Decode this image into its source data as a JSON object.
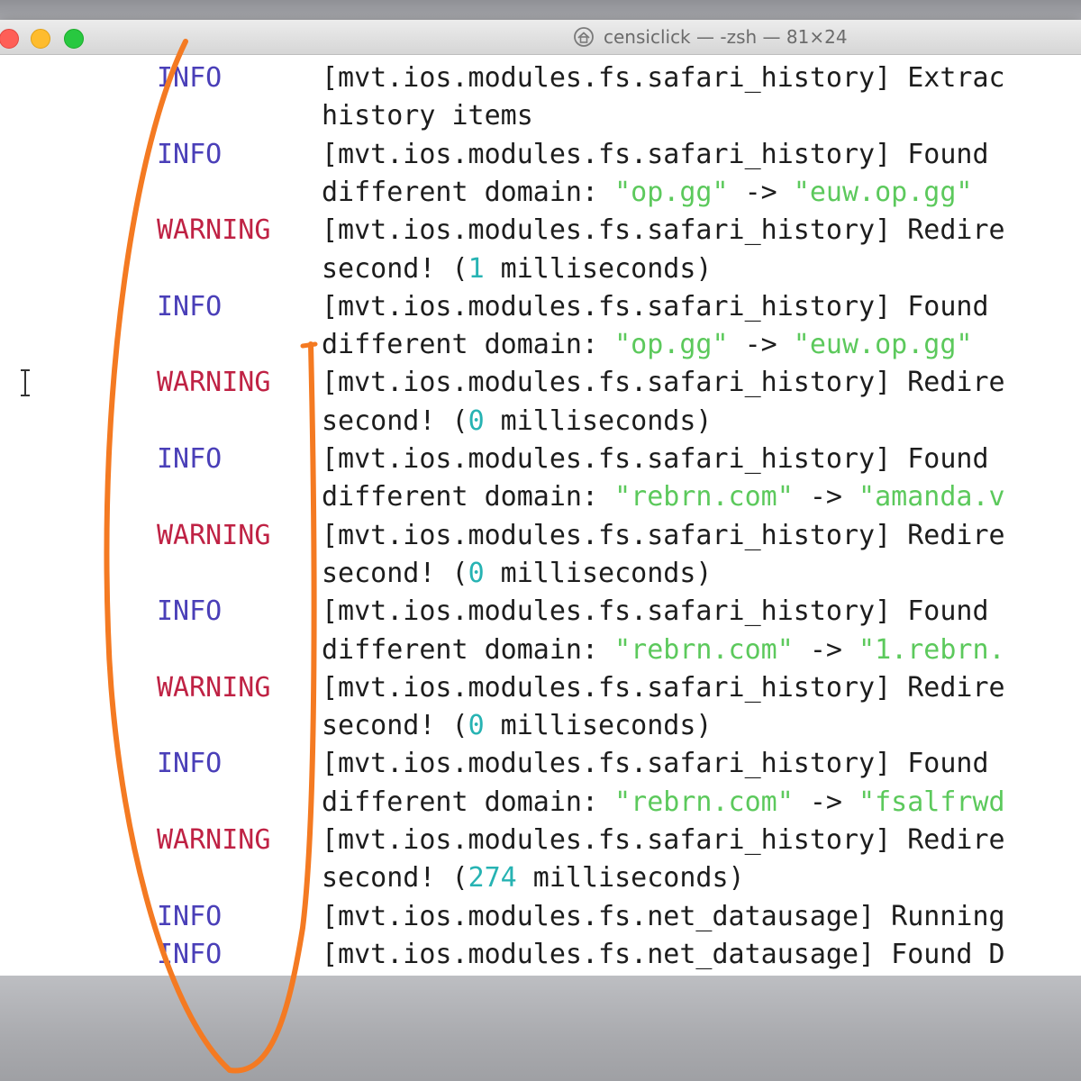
{
  "window": {
    "title": "censiclick — -zsh — 81×24"
  },
  "icons": {
    "title_icon": "home-icon",
    "cursor": "text-cursor-icon"
  },
  "colors": {
    "info": "#4a3fb8",
    "warning": "#bf2244",
    "string": "#5cc95c",
    "number": "#27b3b3",
    "annotation": "#f47a22"
  },
  "log": [
    {
      "level": "INFO",
      "text": "[mvt.ios.modules.fs.safari_history] Extrac"
    },
    {
      "level": "",
      "text": "history items"
    },
    {
      "level": "INFO",
      "text": "[mvt.ios.modules.fs.safari_history] Found"
    },
    {
      "level": "",
      "pre": "different domain: ",
      "s1": "\"op.gg\"",
      "mid": " -> ",
      "s2": "\"euw.op.gg\""
    },
    {
      "level": "WARNING",
      "text": "[mvt.ios.modules.fs.safari_history] Redire"
    },
    {
      "level": "",
      "pre": "second! (",
      "n": "1",
      "post": " milliseconds)"
    },
    {
      "level": "INFO",
      "text": "[mvt.ios.modules.fs.safari_history] Found"
    },
    {
      "level": "",
      "pre": "different domain: ",
      "s1": "\"op.gg\"",
      "mid": " -> ",
      "s2": "\"euw.op.gg\""
    },
    {
      "level": "WARNING",
      "text": "[mvt.ios.modules.fs.safari_history] Redire"
    },
    {
      "level": "",
      "pre": "second! (",
      "n": "0",
      "post": " milliseconds)"
    },
    {
      "level": "INFO",
      "text": "[mvt.ios.modules.fs.safari_history] Found"
    },
    {
      "level": "",
      "pre": "different domain: ",
      "s1": "\"rebrn.com\"",
      "mid": " -> ",
      "s2": "\"amanda.v"
    },
    {
      "level": "WARNING",
      "text": "[mvt.ios.modules.fs.safari_history] Redire"
    },
    {
      "level": "",
      "pre": "second! (",
      "n": "0",
      "post": " milliseconds)"
    },
    {
      "level": "INFO",
      "text": "[mvt.ios.modules.fs.safari_history] Found"
    },
    {
      "level": "",
      "pre": "different domain: ",
      "s1": "\"rebrn.com\"",
      "mid": " -> ",
      "s2": "\"1.rebrn."
    },
    {
      "level": "WARNING",
      "text": "[mvt.ios.modules.fs.safari_history] Redire"
    },
    {
      "level": "",
      "pre": "second! (",
      "n": "0",
      "post": " milliseconds)"
    },
    {
      "level": "INFO",
      "text": "[mvt.ios.modules.fs.safari_history] Found"
    },
    {
      "level": "",
      "pre": "different domain: ",
      "s1": "\"rebrn.com\"",
      "mid": " -> ",
      "s2": "\"fsalfrwd"
    },
    {
      "level": "WARNING",
      "text": "[mvt.ios.modules.fs.safari_history] Redire"
    },
    {
      "level": "",
      "pre": "second! (",
      "n": "274",
      "post": " milliseconds)"
    },
    {
      "level": "INFO",
      "text": "[mvt.ios.modules.fs.net_datausage] Running"
    },
    {
      "level": "INFO",
      "text": "[mvt.ios.modules.fs.net_datausage] Found D"
    }
  ]
}
